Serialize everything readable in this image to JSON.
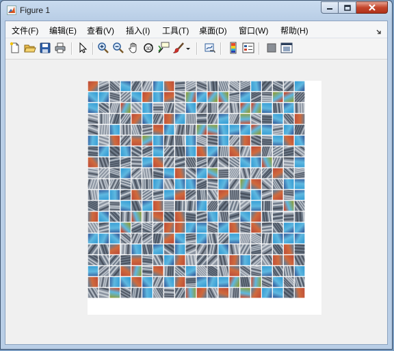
{
  "window": {
    "title": "Figure 1",
    "controls": [
      "minimize-icon",
      "maximize-icon",
      "close-icon"
    ]
  },
  "menubar": {
    "items": [
      {
        "label": "文件(F)"
      },
      {
        "label": "编辑(E)"
      },
      {
        "label": "查看(V)"
      },
      {
        "label": "插入(I)"
      },
      {
        "label": "工具(T)"
      },
      {
        "label": "桌面(D)"
      },
      {
        "label": "窗口(W)"
      },
      {
        "label": "帮助(H)"
      }
    ]
  },
  "toolbar": {
    "buttons": [
      "new-figure-icon",
      "open-file-icon",
      "save-icon",
      "print-icon",
      "edit-plot-icon",
      "zoom-in-icon",
      "zoom-out-icon",
      "pan-icon",
      "rotate-3d-icon",
      "data-cursor-icon",
      "brush-icon",
      "brush-dropdown-icon",
      "link-plot-icon",
      "insert-colorbar-icon",
      "insert-legend-icon",
      "hide-plot-tools-icon",
      "show-plot-tools-icon"
    ]
  },
  "figure": {
    "content": "image mosaic of learned filter patches",
    "grid_rows": 20,
    "grid_cols": 20,
    "background_color": "#f0f0f0",
    "palette": [
      "#6f7b8a",
      "#8a93a0",
      "#3aa0d6",
      "#5fb8e0",
      "#c0523a",
      "#d06a3c",
      "#8aa04a",
      "#4a5868",
      "#b6bcc4",
      "#3c6aa6"
    ]
  }
}
